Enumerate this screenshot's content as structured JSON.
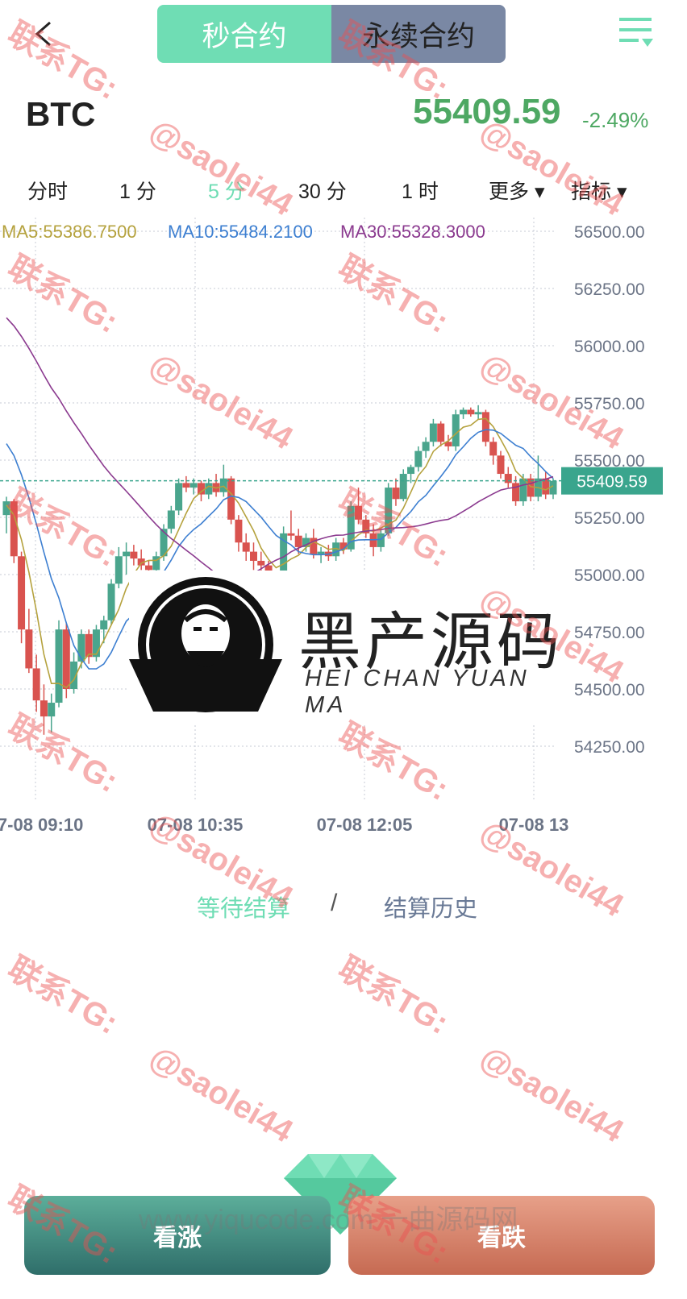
{
  "header": {
    "tab_second": "秒合约",
    "tab_perpetual": "永续合约",
    "symbol": "BTC",
    "price": "55409.59",
    "change": "-2.49%"
  },
  "period_tabs": [
    "分时",
    "1 分",
    "5 分",
    "30 分",
    "1 时",
    "更多 ▾",
    "指标 ▾"
  ],
  "active_period": "5 分",
  "colors": {
    "accent": "#6fddb4",
    "up": "#4aa58d",
    "down": "#d9534f",
    "ma5": "#b5a23e",
    "ma10": "#3d7fd1",
    "ma30": "#8b3a8f",
    "current_price_tag": "#3aa58d"
  },
  "chart_data": {
    "type": "candlestick",
    "ma_labels": {
      "ma5": "MA5:55386.7500",
      "ma10": "MA10:55484.2100",
      "ma30": "MA30:55328.3000"
    },
    "y_ticks": [
      "56500.00",
      "56250.00",
      "56000.00",
      "55750.00",
      "55500.00",
      "55250.00",
      "55000.00",
      "54750.00",
      "54500.00",
      "54250.00"
    ],
    "ylim": [
      54000,
      56550
    ],
    "current_price": "55409.59",
    "x_ticks": [
      "07-08 09:10",
      "07-08 10:35",
      "07-08 12:05",
      "07-08 13"
    ],
    "candles": [
      [
        55260,
        55340,
        55180,
        55320
      ],
      [
        55320,
        55330,
        55050,
        55080
      ],
      [
        55080,
        55100,
        54700,
        54760
      ],
      [
        54760,
        54850,
        54570,
        54590
      ],
      [
        54590,
        54650,
        54400,
        54450
      ],
      [
        54450,
        54520,
        54300,
        54380
      ],
      [
        54380,
        54480,
        54310,
        54440
      ],
      [
        54440,
        54800,
        54420,
        54760
      ],
      [
        54760,
        54790,
        54460,
        54500
      ],
      [
        54500,
        54660,
        54480,
        54620
      ],
      [
        54620,
        54760,
        54590,
        54740
      ],
      [
        54740,
        54760,
        54610,
        54640
      ],
      [
        54640,
        54780,
        54620,
        54760
      ],
      [
        54760,
        54820,
        54700,
        54800
      ],
      [
        54800,
        54980,
        54780,
        54960
      ],
      [
        54960,
        55120,
        54940,
        55080
      ],
      [
        55080,
        55140,
        55000,
        55100
      ],
      [
        55100,
        55130,
        55040,
        55070
      ],
      [
        55070,
        55110,
        55020,
        55040
      ],
      [
        55040,
        55060,
        54980,
        55020
      ],
      [
        55020,
        55100,
        55000,
        55080
      ],
      [
        55080,
        55220,
        55060,
        55200
      ],
      [
        55200,
        55300,
        55180,
        55280
      ],
      [
        55280,
        55420,
        55260,
        55400
      ],
      [
        55400,
        55430,
        55360,
        55380
      ],
      [
        55380,
        55420,
        55350,
        55400
      ],
      [
        55400,
        55410,
        55320,
        55350
      ],
      [
        55350,
        55420,
        55330,
        55400
      ],
      [
        55400,
        55440,
        55340,
        55360
      ],
      [
        55360,
        55480,
        55340,
        55420
      ],
      [
        55420,
        55430,
        55220,
        55240
      ],
      [
        55240,
        55260,
        55100,
        55140
      ],
      [
        55140,
        55180,
        55060,
        55100
      ],
      [
        55100,
        55140,
        55020,
        55060
      ],
      [
        55060,
        55100,
        55000,
        55040
      ],
      [
        55040,
        55060,
        54960,
        54990
      ],
      [
        54990,
        55010,
        54940,
        54960
      ],
      [
        54960,
        55210,
        54950,
        55180
      ],
      [
        55180,
        55280,
        55150,
        55170
      ],
      [
        55170,
        55200,
        55090,
        55120
      ],
      [
        55120,
        55180,
        55100,
        55160
      ],
      [
        55160,
        55200,
        55070,
        55090
      ],
      [
        55090,
        55120,
        55050,
        55100
      ],
      [
        55100,
        55130,
        55060,
        55080
      ],
      [
        55080,
        55160,
        55060,
        55140
      ],
      [
        55140,
        55160,
        55090,
        55110
      ],
      [
        55110,
        55320,
        55100,
        55300
      ],
      [
        55300,
        55380,
        55220,
        55240
      ],
      [
        55240,
        55260,
        55160,
        55180
      ],
      [
        55180,
        55220,
        55080,
        55120
      ],
      [
        55120,
        55200,
        55100,
        55180
      ],
      [
        55180,
        55400,
        55170,
        55380
      ],
      [
        55380,
        55420,
        55300,
        55330
      ],
      [
        55330,
        55460,
        55320,
        55440
      ],
      [
        55440,
        55480,
        55400,
        55470
      ],
      [
        55470,
        55560,
        55450,
        55540
      ],
      [
        55540,
        55600,
        55510,
        55580
      ],
      [
        55580,
        55680,
        55560,
        55660
      ],
      [
        55660,
        55670,
        55560,
        55580
      ],
      [
        55580,
        55610,
        55540,
        55560
      ],
      [
        55560,
        55720,
        55540,
        55700
      ],
      [
        55700,
        55730,
        55680,
        55720
      ],
      [
        55720,
        55730,
        55690,
        55700
      ],
      [
        55700,
        55740,
        55680,
        55710
      ],
      [
        55710,
        55720,
        55560,
        55580
      ],
      [
        55580,
        55600,
        55480,
        55520
      ],
      [
        55520,
        55540,
        55420,
        55440
      ],
      [
        55440,
        55470,
        55380,
        55400
      ],
      [
        55400,
        55430,
        55300,
        55320
      ],
      [
        55320,
        55440,
        55300,
        55420
      ],
      [
        55420,
        55440,
        55320,
        55340
      ],
      [
        55340,
        55520,
        55320,
        55420
      ],
      [
        55420,
        55450,
        55330,
        55350
      ],
      [
        55350,
        55420,
        55330,
        55409.59
      ]
    ]
  },
  "settlement": {
    "pending": "等待结算",
    "separator": "/",
    "history": "结算历史"
  },
  "actions": {
    "buy_up": "看涨",
    "buy_down": "看跌"
  },
  "logo": {
    "title": "黑产源码",
    "subtitle": "HEI CHAN YUAN MA"
  },
  "watermarks": {
    "contact": "联系TG:",
    "handle": "@saolei44",
    "url": "www.yiqucode.com  一曲源码网"
  }
}
